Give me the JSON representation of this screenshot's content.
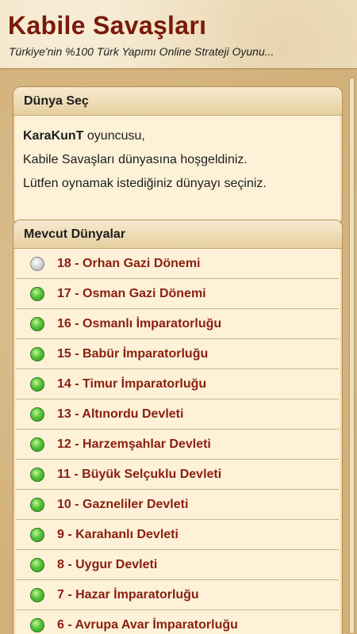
{
  "header": {
    "title": "Kabile Savaşları",
    "subtitle": "Türkiye'nin %100 Türk Yapımı Online Strateji Oyunu..."
  },
  "welcome": {
    "heading": "Dünya Seç",
    "player": "KaraKunT",
    "line1_suffix": " oyuncusu,",
    "line2": "Kabile Savaşları dünyasına hoşgeldiniz.",
    "line3": "Lütfen oynamak istediğiniz dünyayı seçiniz."
  },
  "worlds": {
    "heading": "Mevcut Dünyalar",
    "items": [
      {
        "label": "18 - Orhan Gazi Dönemi",
        "status": "gray"
      },
      {
        "label": "17 - Osman Gazi Dönemi",
        "status": "green"
      },
      {
        "label": "16 - Osmanlı İmparatorluğu",
        "status": "green"
      },
      {
        "label": "15 - Babür İmparatorluğu",
        "status": "green"
      },
      {
        "label": "14 - Timur İmparatorluğu",
        "status": "green"
      },
      {
        "label": "13 - Altınordu Devleti",
        "status": "green"
      },
      {
        "label": "12 - Harzemşahlar Devleti",
        "status": "green"
      },
      {
        "label": "11 - Büyük Selçuklu Devleti",
        "status": "green"
      },
      {
        "label": "10 - Gazneliler Devleti",
        "status": "green"
      },
      {
        "label": "9 - Karahanlı Devleti",
        "status": "green"
      },
      {
        "label": "8 - Uygur Devleti",
        "status": "green"
      },
      {
        "label": "7 - Hazar İmparatorluğu",
        "status": "green"
      },
      {
        "label": "6 - Avrupa Avar İmparatorluğu",
        "status": "green"
      }
    ]
  },
  "colors": {
    "title": "#7a1a0a",
    "world_label": "#8a1f10",
    "online": "#54c33a",
    "inactive": "#d4d4d4"
  }
}
